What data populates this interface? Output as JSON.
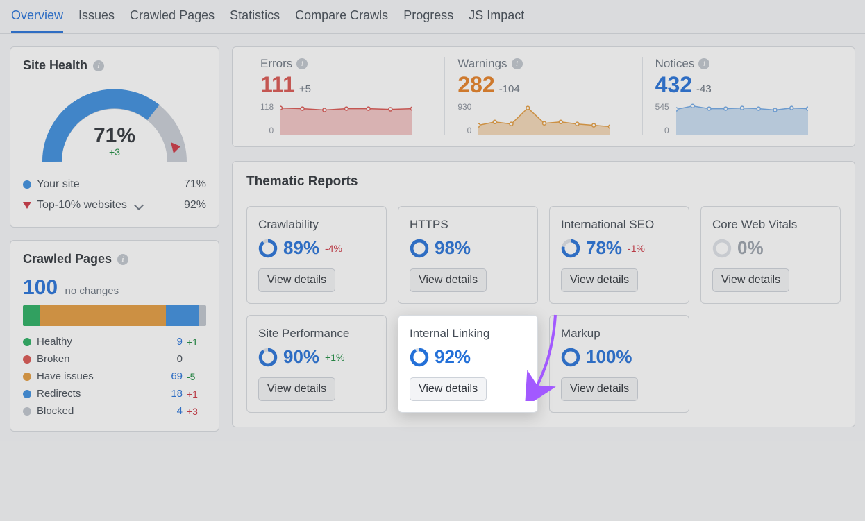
{
  "tabs": [
    {
      "label": "Overview",
      "active": true
    },
    {
      "label": "Issues",
      "active": false
    },
    {
      "label": "Crawled Pages",
      "active": false
    },
    {
      "label": "Statistics",
      "active": false
    },
    {
      "label": "Compare Crawls",
      "active": false
    },
    {
      "label": "Progress",
      "active": false
    },
    {
      "label": "JS Impact",
      "active": false
    }
  ],
  "siteHealth": {
    "title": "Site Health",
    "value": "71%",
    "delta": "+3",
    "legend": [
      {
        "label": "Your site",
        "value": "71%",
        "color": "#3a8dde",
        "type": "dot"
      },
      {
        "label": "Top-10% websites",
        "value": "92%",
        "type": "tri"
      }
    ]
  },
  "crawledPages": {
    "title": "Crawled Pages",
    "total": "100",
    "subtitle": "no changes",
    "segments": [
      {
        "color": "#27ae60",
        "pct": 9
      },
      {
        "color": "#e39a3c",
        "pct": 69
      },
      {
        "color": "#3a8dde",
        "pct": 18
      },
      {
        "color": "#bfc5cd",
        "pct": 4
      }
    ],
    "rows": [
      {
        "label": "Healthy",
        "color": "#27ae60",
        "value": "9",
        "delta": "+1",
        "deltaClass": "pos"
      },
      {
        "label": "Broken",
        "color": "#d9534f",
        "value": "0",
        "delta": "",
        "deltaClass": ""
      },
      {
        "label": "Have issues",
        "color": "#e39a3c",
        "value": "69",
        "delta": "-5",
        "deltaClass": "pos"
      },
      {
        "label": "Redirects",
        "color": "#3a8dde",
        "value": "18",
        "delta": "+1",
        "deltaClass": "neg"
      },
      {
        "label": "Blocked",
        "color": "#bfc5cd",
        "value": "4",
        "delta": "+3",
        "deltaClass": "neg"
      }
    ]
  },
  "summary": [
    {
      "label": "Errors",
      "value": "111",
      "delta": "+5",
      "color": "#d9534f",
      "axisTop": "118",
      "axisBot": "0",
      "fill": "#f2c4c4",
      "stroke": "#d9534f",
      "points": [
        0.82,
        0.8,
        0.76,
        0.8,
        0.8,
        0.78,
        0.8
      ]
    },
    {
      "label": "Warnings",
      "value": "282",
      "delta": "-104",
      "color": "#e67e22",
      "axisTop": "930",
      "axisBot": "0",
      "fill": "#f3d7b6",
      "stroke": "#e39a3c",
      "points": [
        0.3,
        0.4,
        0.34,
        0.82,
        0.36,
        0.4,
        0.34,
        0.3,
        0.26
      ]
    },
    {
      "label": "Notices",
      "value": "432",
      "delta": "-43",
      "color": "#2370d8",
      "axisTop": "545",
      "axisBot": "0",
      "fill": "#c9ddf2",
      "stroke": "#6fa8e6",
      "points": [
        0.78,
        0.88,
        0.8,
        0.8,
        0.82,
        0.8,
        0.76,
        0.82,
        0.8
      ]
    }
  ],
  "thematic": {
    "title": "Thematic Reports",
    "viewDetails": "View details",
    "reports": [
      {
        "title": "Crawlability",
        "pct": "89%",
        "pctNum": 89,
        "delta": "-4%",
        "deltaClass": "neg",
        "color": "#2370d8",
        "highlight": false
      },
      {
        "title": "HTTPS",
        "pct": "98%",
        "pctNum": 98,
        "delta": "",
        "deltaClass": "",
        "color": "#2370d8",
        "highlight": false
      },
      {
        "title": "International SEO",
        "pct": "78%",
        "pctNum": 78,
        "delta": "-1%",
        "deltaClass": "neg",
        "color": "#2370d8",
        "highlight": false
      },
      {
        "title": "Core Web Vitals",
        "pct": "0%",
        "pctNum": 0,
        "delta": "",
        "deltaClass": "",
        "color": "#9aa1ab",
        "pctColor": "#9aa1ab",
        "highlight": false
      },
      {
        "title": "Site Performance",
        "pct": "90%",
        "pctNum": 90,
        "delta": "+1%",
        "deltaClass": "pos",
        "color": "#2370d8",
        "highlight": false
      },
      {
        "title": "Internal Linking",
        "pct": "92%",
        "pctNum": 92,
        "delta": "",
        "deltaClass": "",
        "color": "#2370d8",
        "highlight": true
      },
      {
        "title": "Markup",
        "pct": "100%",
        "pctNum": 100,
        "delta": "",
        "deltaClass": "",
        "color": "#2370d8",
        "highlight": false
      }
    ]
  },
  "chart_data": [
    {
      "type": "line",
      "title": "Errors",
      "ylim": [
        0,
        118
      ],
      "values": [
        97,
        94,
        90,
        94,
        94,
        92,
        94
      ]
    },
    {
      "type": "line",
      "title": "Warnings",
      "ylim": [
        0,
        930
      ],
      "values": [
        279,
        372,
        316,
        763,
        335,
        372,
        316,
        279,
        242
      ]
    },
    {
      "type": "line",
      "title": "Notices",
      "ylim": [
        0,
        545
      ],
      "values": [
        425,
        480,
        436,
        436,
        447,
        436,
        414,
        447,
        436
      ]
    }
  ]
}
